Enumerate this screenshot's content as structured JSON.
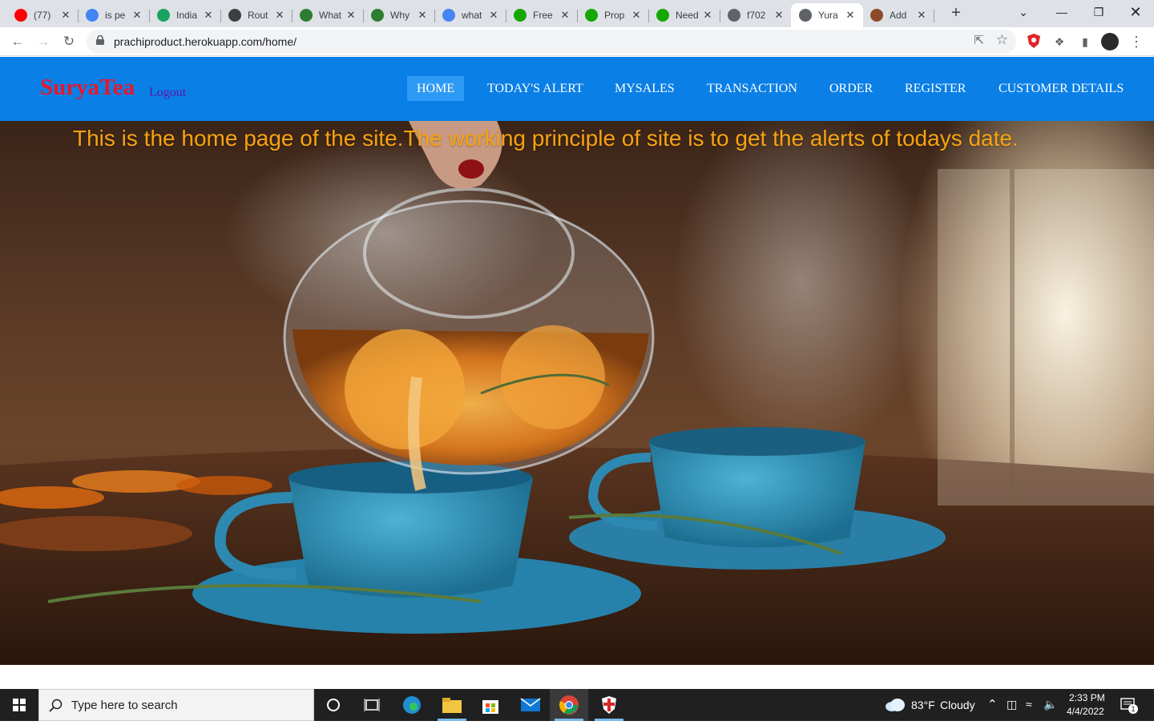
{
  "browser": {
    "tabs": [
      {
        "title": "(77)",
        "favicon": "youtube-icon",
        "color": "#ff0000"
      },
      {
        "title": "is pe",
        "favicon": "google-icon",
        "color": "#4285f4"
      },
      {
        "title": "India",
        "favicon": "cb-icon",
        "color": "#1aa260"
      },
      {
        "title": "Rout",
        "favicon": "document-icon",
        "color": "#3c4043"
      },
      {
        "title": "What",
        "favicon": "gg-icon",
        "color": "#2e7d32"
      },
      {
        "title": "Why",
        "favicon": "gg-icon",
        "color": "#2e7d32"
      },
      {
        "title": "what",
        "favicon": "google-icon",
        "color": "#4285f4"
      },
      {
        "title": "Free",
        "favicon": "upwork-icon",
        "color": "#14a800"
      },
      {
        "title": "Prop",
        "favicon": "upwork-icon",
        "color": "#14a800"
      },
      {
        "title": "Need",
        "favicon": "upwork-icon",
        "color": "#14a800"
      },
      {
        "title": "f702",
        "favicon": "globe-icon",
        "color": "#5f6368"
      },
      {
        "title": "Yura",
        "favicon": "globe-icon",
        "color": "#5f6368"
      },
      {
        "title": "Add",
        "favicon": "extension-icon",
        "color": "#8d4a2a"
      }
    ],
    "active_tab_index": 11,
    "url": "prachiproduct.herokuapp.com/home/"
  },
  "site": {
    "brand": "SuryaTea",
    "logout": "Logout",
    "nav": [
      "HOME",
      "TODAY'S ALERT",
      "MYSALES",
      "TRANSACTION",
      "ORDER",
      "REGISTER",
      "CUSTOMER DETAILS"
    ],
    "active_nav": "HOME",
    "headline": "This is the home page of the site.The working principle of site is to get the alerts of todays date.",
    "colors": {
      "header_bg": "#0a7fe6",
      "brand": "#e8172d",
      "headline": "#f7a30f",
      "logout": "#5a16a8"
    }
  },
  "taskbar": {
    "search_placeholder": "Type here to search",
    "weather": {
      "temp": "83°F",
      "condition": "Cloudy"
    },
    "time": "2:33 PM",
    "date": "4/4/2022",
    "notification_count": "1"
  }
}
